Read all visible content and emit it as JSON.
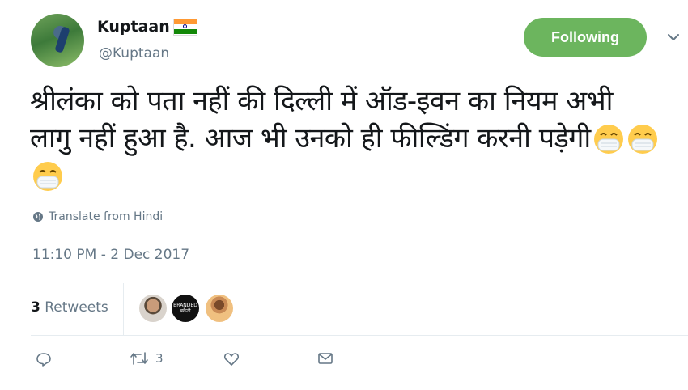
{
  "user": {
    "name": "Kuptaan",
    "handle": "@Kuptaan",
    "follow_label": "Following"
  },
  "tweet": {
    "text": "श्रीलंका को पता नहीं की दिल्ली में ऑड-इवन का नियम अभी लागु नहीं हुआ है. आज भी उनको ही फील्डिंग करनी पड़ेगी",
    "emoji": [
      "face-with-medical-mask",
      "face-with-medical-mask",
      "face-with-medical-mask"
    ],
    "translate_label": "Translate from Hindi",
    "timestamp": "11:10 PM - 2 Dec 2017"
  },
  "stats": {
    "retweet_count": "3",
    "retweet_label": "Retweets",
    "retweeter_2_text": [
      "BRANDED",
      "बकैती"
    ]
  },
  "actions": {
    "retweet_count": "3"
  },
  "colors": {
    "follow_bg": "#6cb55e",
    "muted": "#657786"
  }
}
